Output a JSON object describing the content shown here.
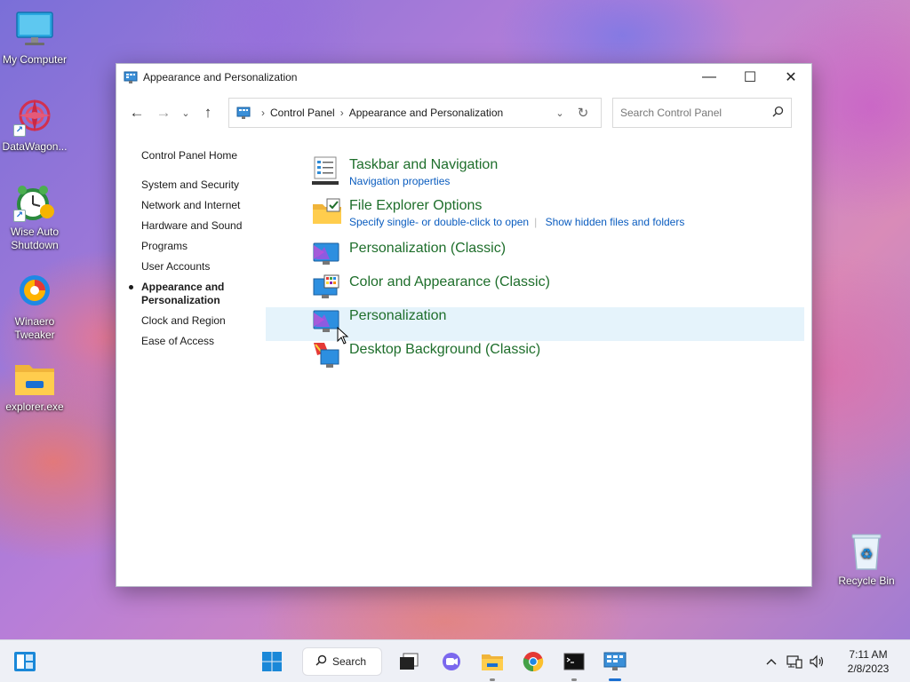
{
  "desktop": {
    "icons": [
      {
        "label": "My Computer"
      },
      {
        "label": "DataWagon..."
      },
      {
        "label": "Wise Auto Shutdown"
      },
      {
        "label": "Winaero Tweaker"
      },
      {
        "label": "explorer.exe"
      },
      {
        "label": "Recycle Bin"
      }
    ]
  },
  "window": {
    "title": "Appearance and Personalization",
    "controls": {
      "minimize": "—",
      "maximize": "☐",
      "close": "✕"
    },
    "nav": {
      "back": "←",
      "forward": "→",
      "recent": "⌄",
      "up": "↑"
    },
    "address": {
      "crumbs": [
        "Control Panel",
        "Appearance and Personalization"
      ],
      "separator": "›"
    },
    "search": {
      "placeholder": "Search Control Panel"
    },
    "sidebar": {
      "home": "Control Panel Home",
      "items": [
        {
          "label": "System and Security"
        },
        {
          "label": "Network and Internet"
        },
        {
          "label": "Hardware and Sound"
        },
        {
          "label": "Programs"
        },
        {
          "label": "User Accounts"
        },
        {
          "label": "Appearance and Personalization",
          "current": true
        },
        {
          "label": "Clock and Region"
        },
        {
          "label": "Ease of Access"
        }
      ]
    },
    "categories": [
      {
        "title": "Taskbar and Navigation",
        "links": [
          "Navigation properties"
        ],
        "icon": "taskbar-icon"
      },
      {
        "title": "File Explorer Options",
        "links": [
          "Specify single- or double-click to open",
          "Show hidden files and folders"
        ],
        "icon": "folder-options-icon"
      },
      {
        "title": "Personalization (Classic)",
        "links": [],
        "icon": "personalization-icon"
      },
      {
        "title": "Color and Appearance (Classic)",
        "links": [],
        "icon": "color-appearance-icon"
      },
      {
        "title": "Personalization",
        "links": [],
        "icon": "personalization-icon",
        "hover": true
      },
      {
        "title": "Desktop Background (Classic)",
        "links": [],
        "icon": "desktop-background-icon"
      }
    ]
  },
  "taskbar": {
    "search_label": "Search",
    "apps": [
      "start",
      "search",
      "task-view",
      "chat",
      "file-explorer",
      "chrome",
      "terminal",
      "control-panel"
    ],
    "clock": {
      "time": "7:11 AM",
      "date": "2/8/2023"
    }
  },
  "colors": {
    "category_title": "#1e6e2b",
    "link": "#0a5cbf",
    "hover_row": "#e5f3fb",
    "taskbar": "#eef0f6",
    "accent": "#1a6fd1"
  }
}
